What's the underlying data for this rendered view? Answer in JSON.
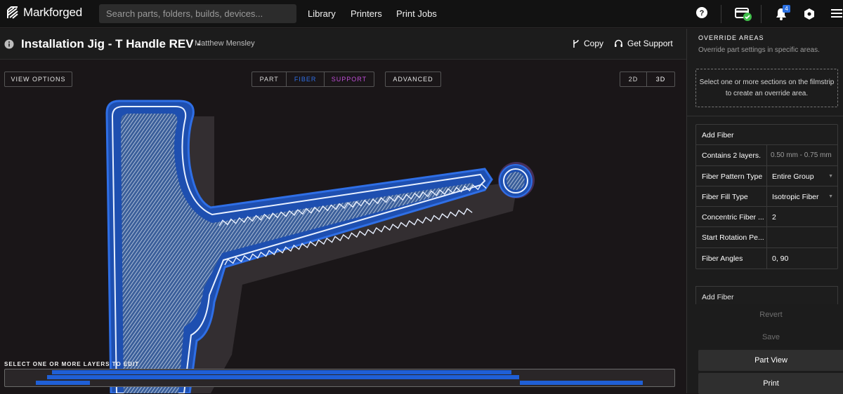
{
  "topbar": {
    "brand": "Markforged",
    "search_placeholder": "Search parts, folders, builds, devices...",
    "nav": [
      "Library",
      "Printers",
      "Print Jobs"
    ],
    "notification_count": "4"
  },
  "header": {
    "title": "Installation Jig - T Handle REV -",
    "author": "Matthew Mensley",
    "copy_label": "Copy",
    "support_label": "Get Support"
  },
  "viewport": {
    "view_options": "VIEW OPTIONS",
    "modes": [
      "PART",
      "FIBER",
      "SUPPORT"
    ],
    "advanced": "ADVANCED",
    "dims": [
      "2D",
      "3D"
    ],
    "layers_label": "SELECT ONE OR MORE LAYERS TO EDIT"
  },
  "sidebar": {
    "heading": "OVERRIDE AREAS",
    "subheading": "Override part settings in specific areas.",
    "hint": "Select one or more sections on the filmstrip to create an override area.",
    "fiber_table": {
      "title": "Add Fiber",
      "rows": [
        {
          "label": "Contains 2 layers.",
          "value": "0.50 mm - 0.75 mm"
        },
        {
          "label": "Fiber Pattern Type",
          "value": "Entire Group"
        },
        {
          "label": "Fiber Fill Type",
          "value": "Isotropic Fiber"
        },
        {
          "label": "Concentric Fiber ...",
          "value": "2"
        },
        {
          "label": "Start Rotation Pe...",
          "value": ""
        },
        {
          "label": "Fiber Angles",
          "value": "0, 90"
        }
      ]
    },
    "add_fiber_2": "Add Fiber",
    "revert": "Revert",
    "save": "Save",
    "part_view": "Part View",
    "print": "Print"
  },
  "colors": {
    "fiber": "#2f6fe6",
    "support": "#c04ed8",
    "accent_blue": "#2a6fe0"
  }
}
